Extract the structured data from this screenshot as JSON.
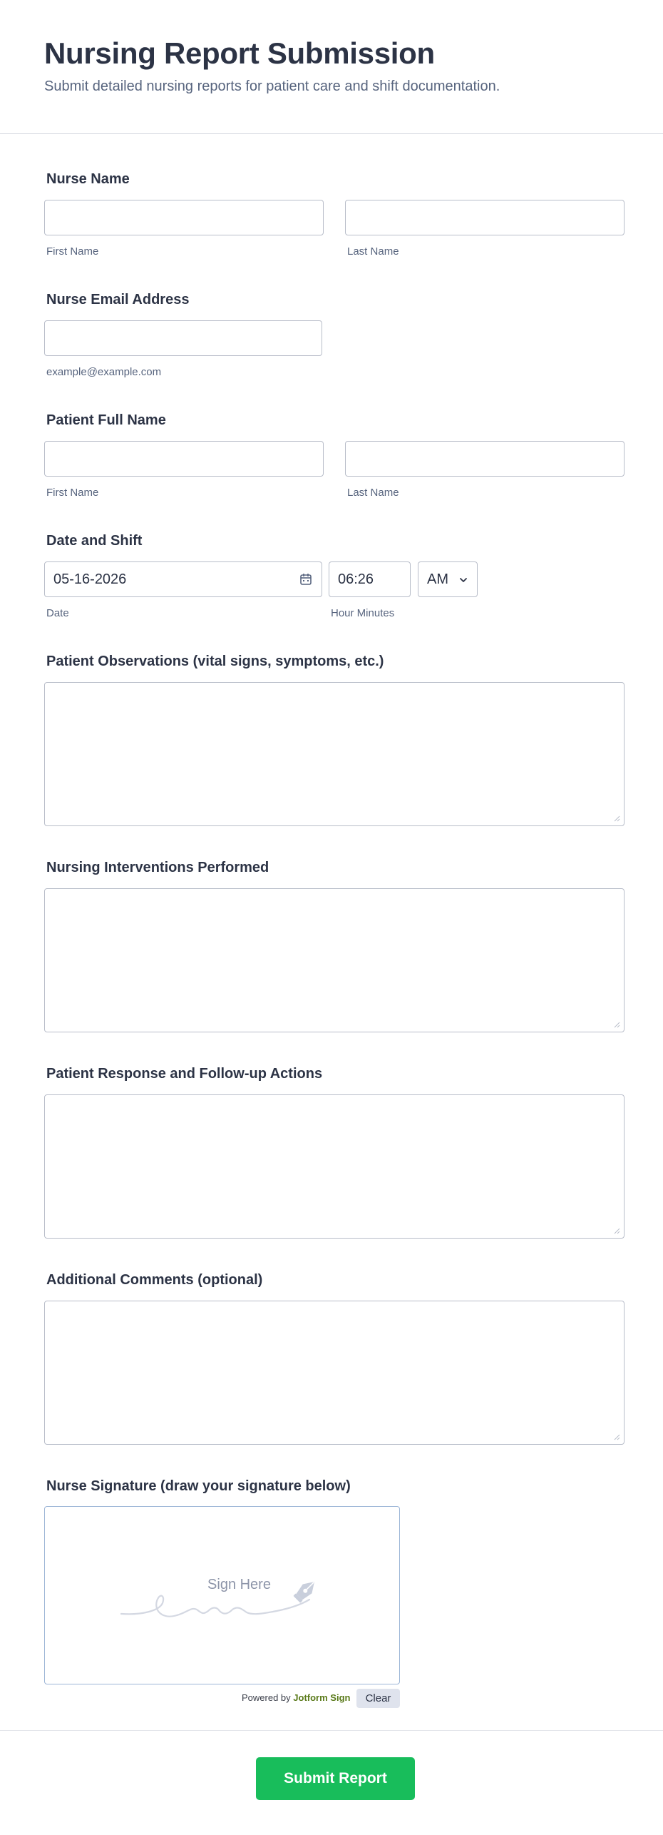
{
  "header": {
    "title": "Nursing Report Submission",
    "subtitle": "Submit detailed nursing reports for patient care and shift documentation."
  },
  "nurse_name": {
    "label": "Nurse Name",
    "first_value": "",
    "last_value": "",
    "first_sublabel": "First Name",
    "last_sublabel": "Last Name"
  },
  "nurse_email": {
    "label": "Nurse Email Address",
    "value": "",
    "sublabel": "example@example.com"
  },
  "patient_name": {
    "label": "Patient Full Name",
    "first_value": "",
    "last_value": "",
    "first_sublabel": "First Name",
    "last_sublabel": "Last Name"
  },
  "date_shift": {
    "label": "Date and Shift",
    "date_value": "05-16-2026",
    "time_value": "06:26",
    "ampm_value": "AM",
    "date_sublabel": "Date",
    "time_sublabel": "Hour Minutes",
    "icons": [
      "calendar-icon",
      "chevron-down-icon"
    ]
  },
  "observations": {
    "label": "Patient Observations (vital signs, symptoms, etc.)",
    "value": ""
  },
  "interventions": {
    "label": "Nursing Interventions Performed",
    "value": ""
  },
  "response": {
    "label": "Patient Response and Follow-up Actions",
    "value": ""
  },
  "comments": {
    "label": "Additional Comments (optional)",
    "value": ""
  },
  "signature": {
    "label": "Nurse Signature (draw your signature below)",
    "placeholder": "Sign Here",
    "powered_prefix": "Powered by",
    "powered_brand": "Jotform Sign",
    "clear_label": "Clear",
    "icons": [
      "pen-nib-icon"
    ]
  },
  "submit_label": "Submit Report",
  "colors": {
    "text": "#2c3345",
    "muted": "#57647e",
    "border": "#b8bdc9",
    "submit": "#18bd5b",
    "signature_border": "#9cb5d6"
  }
}
